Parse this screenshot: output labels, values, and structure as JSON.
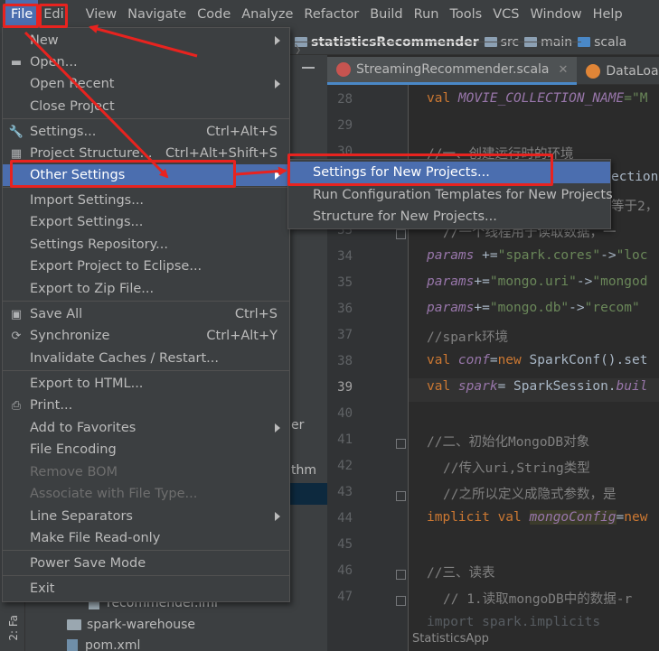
{
  "menubar": {
    "items": [
      "File",
      "Edi",
      "View",
      "Navigate",
      "Code",
      "Analyze",
      "Refactor",
      "Build",
      "Run",
      "Tools",
      "VCS",
      "Window",
      "Help"
    ]
  },
  "breadcrumb": {
    "project": "statisticsRecommender",
    "folders": [
      "src",
      "main",
      "scala"
    ]
  },
  "tabs": [
    {
      "label": "StreamingRecommender.scala",
      "icon": "scala-file-icon"
    },
    {
      "label": "DataLoade",
      "icon": "scala-object-icon"
    }
  ],
  "project_tree": {
    "fragment_er": "er",
    "fragment_thm": "thm",
    "items": [
      {
        "label": "recommender.iml",
        "icon": "module-file-icon"
      },
      {
        "label": "spark-warehouse",
        "icon": "folder-icon"
      },
      {
        "label": "pom.xml",
        "icon": "maven-file-icon"
      }
    ],
    "side_label": "2: Fa"
  },
  "file_menu": {
    "items": [
      {
        "label": "New",
        "submenu": true
      },
      {
        "label": "Open...",
        "icon": "folder-open-icon"
      },
      {
        "label": "Open Recent",
        "submenu": true
      },
      {
        "label": "Close Project"
      },
      {
        "label": "Settings...",
        "shortcut": "Ctrl+Alt+S",
        "icon": "wrench-icon"
      },
      {
        "label": "Project Structure...",
        "shortcut": "Ctrl+Alt+Shift+S",
        "icon": "project-structure-icon"
      },
      {
        "label": "Other Settings",
        "submenu": true,
        "highlighted": true
      },
      {
        "label": "Import Settings..."
      },
      {
        "label": "Export Settings..."
      },
      {
        "label": "Settings Repository..."
      },
      {
        "label": "Export Project to Eclipse..."
      },
      {
        "label": "Export to Zip File..."
      },
      {
        "label": "Save All",
        "shortcut": "Ctrl+S",
        "icon": "save-icon"
      },
      {
        "label": "Synchronize",
        "shortcut": "Ctrl+Alt+Y",
        "icon": "sync-icon"
      },
      {
        "label": "Invalidate Caches / Restart..."
      },
      {
        "label": "Export to HTML..."
      },
      {
        "label": "Print...",
        "icon": "print-icon"
      },
      {
        "label": "Add to Favorites",
        "submenu": true
      },
      {
        "label": "File Encoding"
      },
      {
        "label": "Remove BOM",
        "disabled": true
      },
      {
        "label": "Associate with File Type...",
        "disabled": true
      },
      {
        "label": "Line Separators",
        "submenu": true
      },
      {
        "label": "Make File Read-only"
      },
      {
        "label": "Power Save Mode"
      },
      {
        "label": "Exit"
      }
    ]
  },
  "other_settings_submenu": {
    "items": [
      {
        "label": "Settings for New Projects...",
        "highlighted": true
      },
      {
        "label": "Run Configuration Templates for New Projects"
      },
      {
        "label": "Structure for New Projects..."
      }
    ]
  },
  "editor": {
    "line_numbers": [
      "28",
      "29",
      "30",
      "31",
      "32",
      "33",
      "34",
      "35",
      "36",
      "37",
      "38",
      "39",
      "40",
      "41",
      "42",
      "43",
      "44",
      "45",
      "46",
      "47"
    ],
    "current_line": "39",
    "lines": {
      "l28": {
        "kw": "val ",
        "var": "MOVIE_COLLECTION_NAME",
        "rest": "=\"M"
      },
      "l30": "//一、创建运行时的环境",
      "l31": "ection.",
      "l32": "等于2，",
      "l33": "//一个线程用于读取数据，一",
      "l34": {
        "var": "params",
        "op": " +=",
        "str1": "\"spark.cores\"",
        "arrow": "->",
        "str2": "\"loc"
      },
      "l35": {
        "var": "params",
        "op": "+=",
        "str1": "\"mongo.uri\"",
        "arrow": "->",
        "str2": "\"mongod"
      },
      "l36": {
        "var": "params",
        "op": "+=",
        "str1": "\"mongo.db\"",
        "arrow": "->",
        "str2": "\"recom\""
      },
      "l37": "//spark环境",
      "l38": {
        "kw": "val ",
        "var": "conf",
        "op": "=",
        "kw2": "new ",
        "rest": "SparkConf().set"
      },
      "l39": {
        "kw": "val ",
        "var": "spark",
        "rest": "= SparkSession.",
        "it": "buil"
      },
      "l41": "//二、初始化MongoDB对象",
      "l42": "//传入uri,String类型",
      "l43": "//之所以定义成隐式参数，是",
      "l44": {
        "kw": "implicit val ",
        "var": "mongoConfig",
        "op": "=",
        "kw2": "new"
      },
      "l46": "//三、读表",
      "l47": "// 1.读取mongoDB中的数据-r",
      "l48": "import spark.implicits"
    },
    "hint": "StatisticsApp"
  },
  "colors": {
    "menu_bg": "#3c3f41",
    "highlight": "#4b6eaf",
    "annotation": "#e8231f",
    "editor_bg": "#2b2b2b"
  }
}
